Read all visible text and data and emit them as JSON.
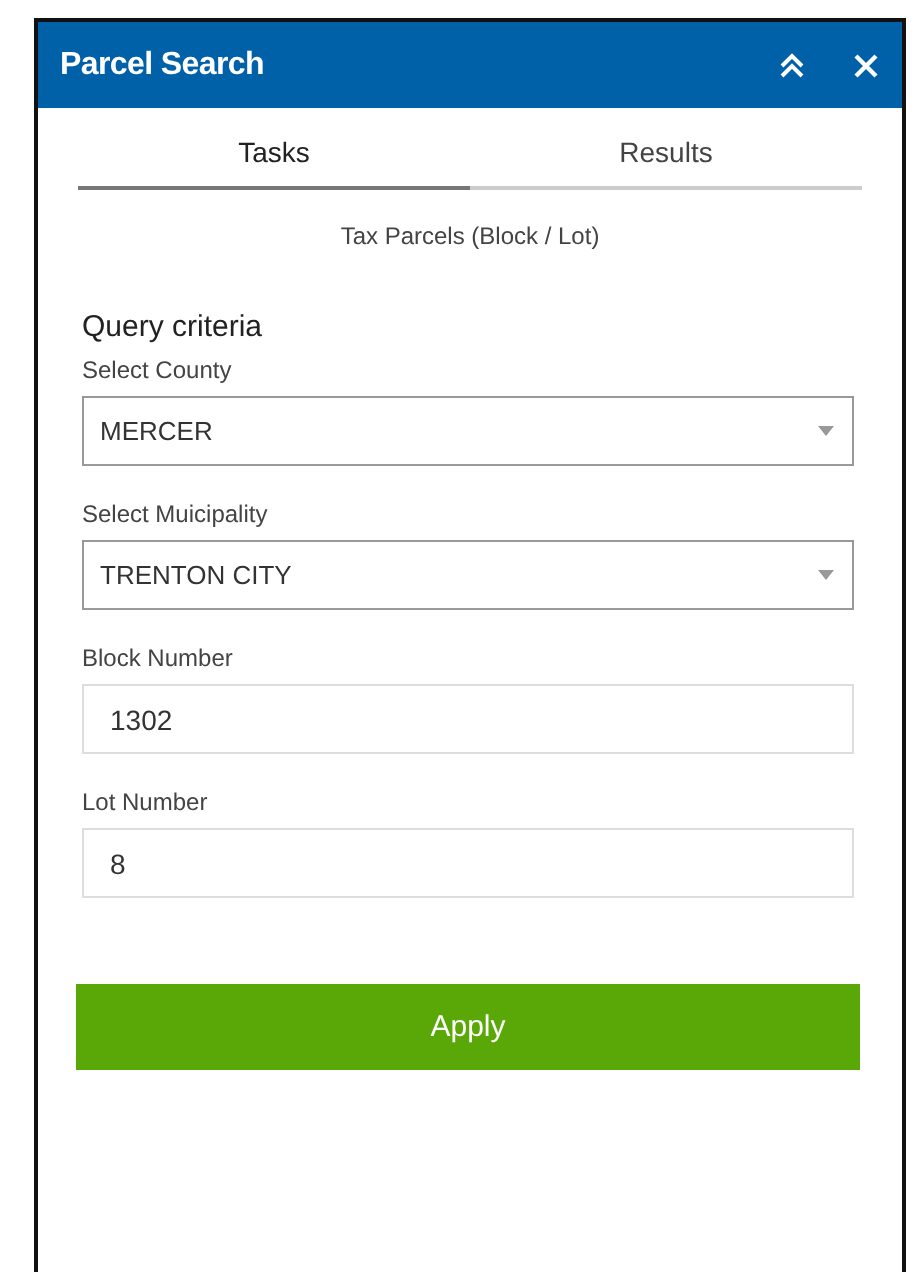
{
  "window": {
    "title": "Parcel Search"
  },
  "tabs": [
    {
      "label": "Tasks",
      "selected": true
    },
    {
      "label": "Results",
      "selected": false
    }
  ],
  "subtitle": "Tax Parcels (Block / Lot)",
  "section_title": "Query criteria",
  "fields": [
    {
      "kind": "select",
      "label": "Select County",
      "value": "MERCER"
    },
    {
      "kind": "select",
      "label": "Select Muicipality",
      "value": "TRENTON CITY"
    },
    {
      "kind": "text",
      "label": "Block Number",
      "value": "1302"
    },
    {
      "kind": "text",
      "label": "Lot Number",
      "value": "8"
    }
  ],
  "buttons": [
    "Apply"
  ]
}
